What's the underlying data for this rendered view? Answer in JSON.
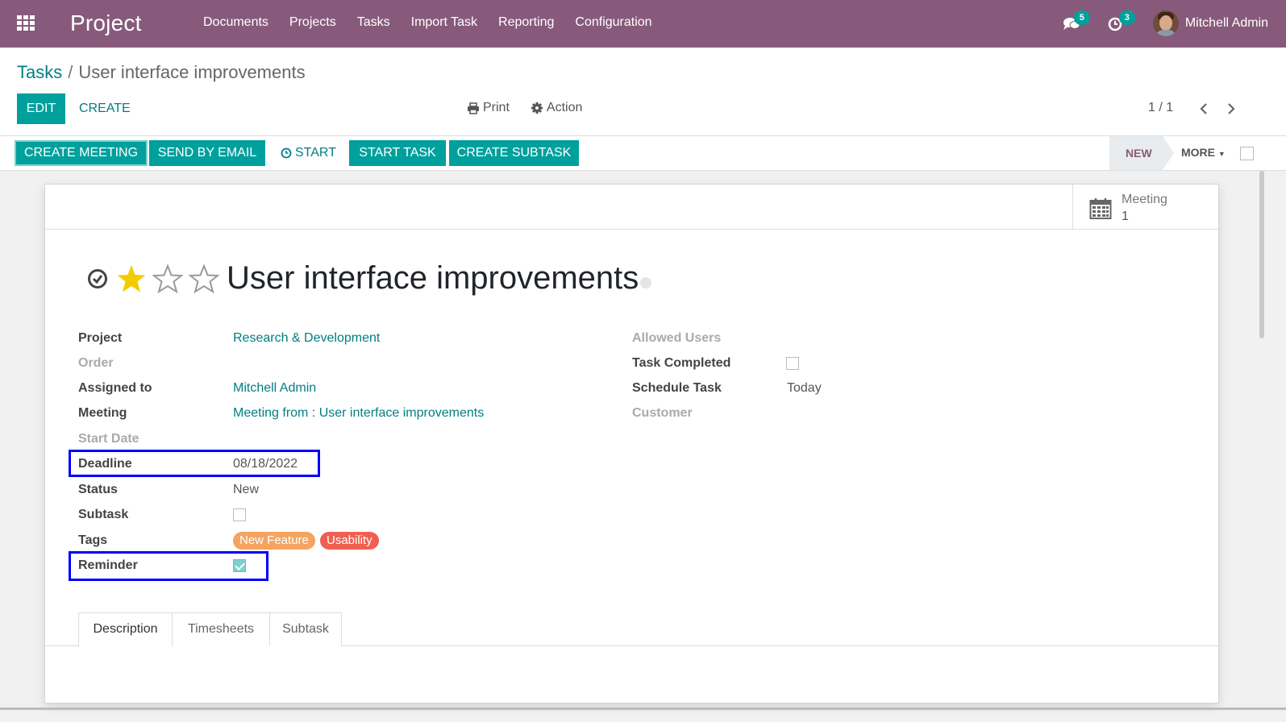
{
  "navbar": {
    "app_title": "Project",
    "menu": [
      "Documents",
      "Projects",
      "Tasks",
      "Import Task",
      "Reporting",
      "Configuration"
    ],
    "messages_badge": "5",
    "activities_badge": "3",
    "user_name": "Mitchell Admin",
    "color": "#875a7b"
  },
  "control_panel": {
    "breadcrumb_parent": "Tasks",
    "breadcrumb_separator": "/",
    "breadcrumb_current": "User interface improvements",
    "edit_label": "EDIT",
    "create_label": "CREATE",
    "print_label": "Print",
    "action_label": "Action",
    "pager": "1 / 1"
  },
  "statusbar": {
    "buttons": [
      "CREATE MEETING",
      "SEND BY EMAIL",
      "START",
      "START TASK",
      "CREATE SUBTASK"
    ],
    "stage": "NEW",
    "more_label": "MORE"
  },
  "smart_button": {
    "label": "Meeting",
    "count": "1"
  },
  "record": {
    "title": "User interface improvements",
    "priority_stars": 1,
    "priority_max": 3
  },
  "fields_left": {
    "project_label": "Project",
    "project_value": "Research & Development",
    "order_label": "Order",
    "assigned_label": "Assigned to",
    "assigned_value": "Mitchell Admin",
    "meeting_label": "Meeting",
    "meeting_value": "Meeting from : User interface improvements",
    "start_date_label": "Start Date",
    "deadline_label": "Deadline",
    "deadline_value": "08/18/2022",
    "status_label": "Status",
    "status_value": "New",
    "subtask_label": "Subtask",
    "tags_label": "Tags",
    "tags": [
      {
        "name": "New Feature",
        "color": "#f4a460"
      },
      {
        "name": "Usability",
        "color": "#f06050"
      }
    ],
    "reminder_label": "Reminder",
    "reminder_checked": true,
    "subtask_checked": false
  },
  "fields_right": {
    "allowed_users_label": "Allowed Users",
    "task_completed_label": "Task Completed",
    "task_completed_checked": false,
    "schedule_label": "Schedule Task",
    "schedule_value": "Today",
    "customer_label": "Customer"
  },
  "tabs": [
    "Description",
    "Timesheets",
    "Subtask"
  ],
  "accent": "#00a09d",
  "highlight_color": "#0000ff"
}
